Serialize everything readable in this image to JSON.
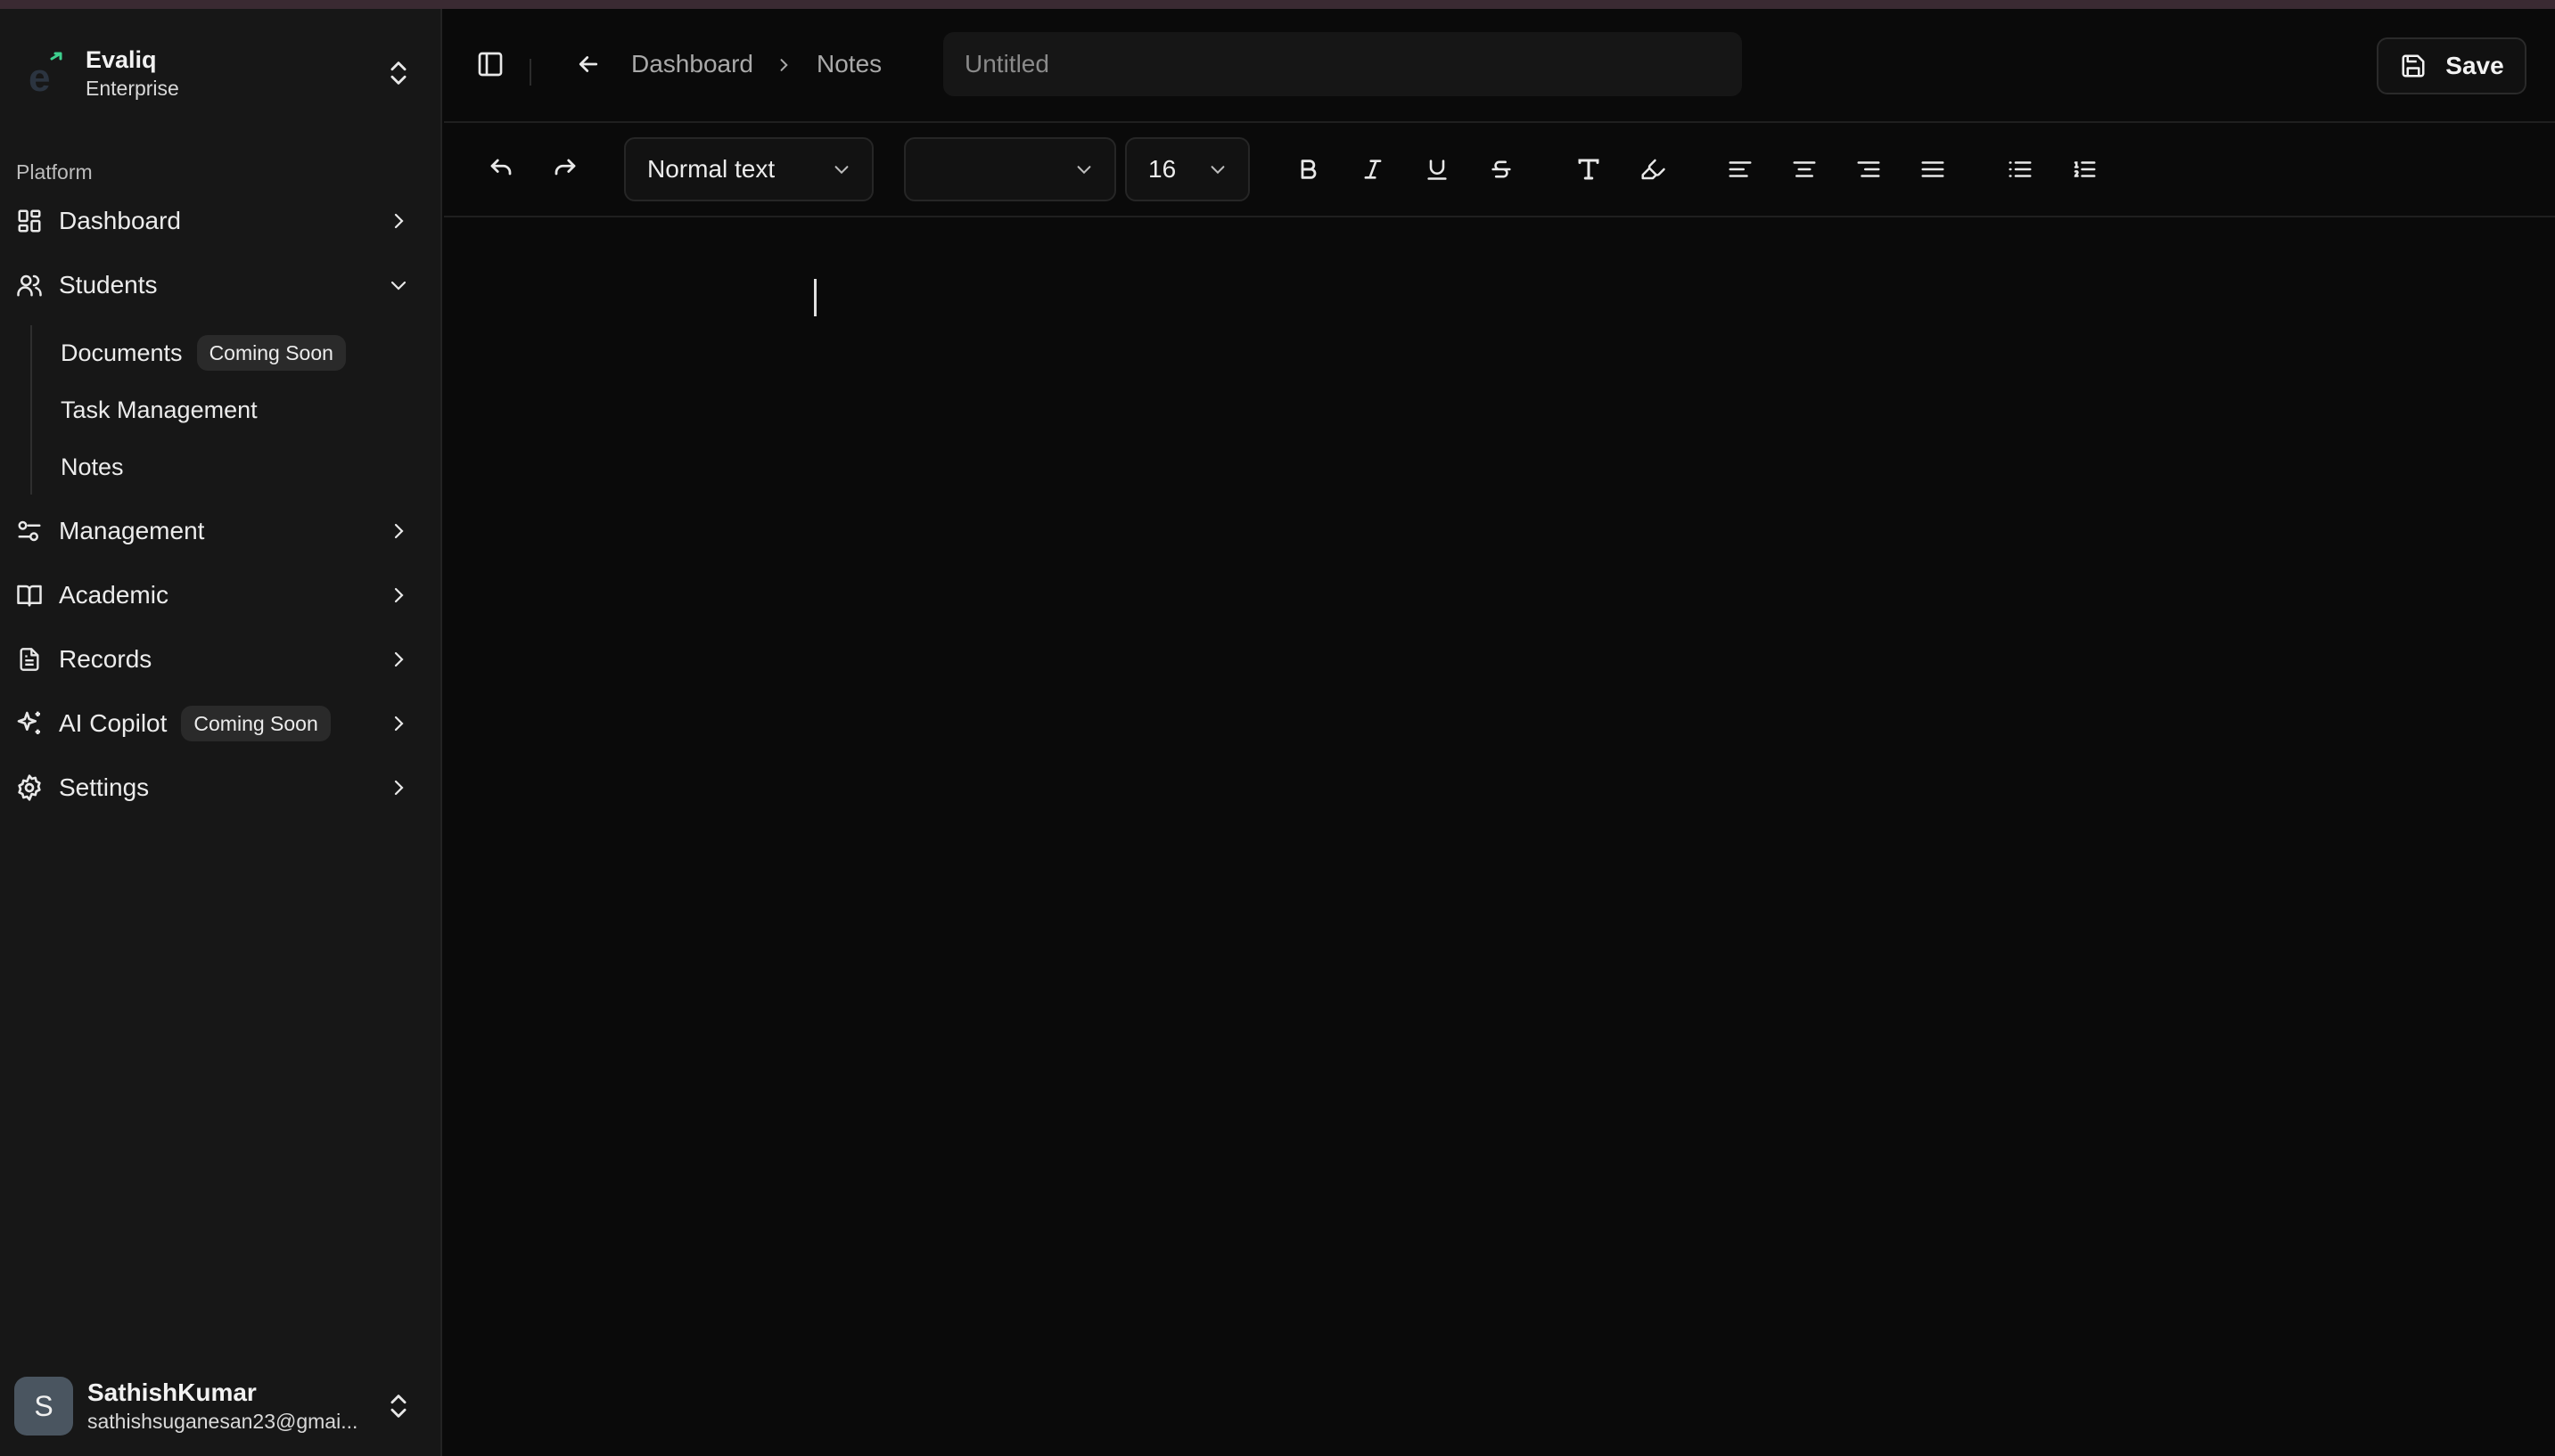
{
  "brand": {
    "name": "Evaliq",
    "plan": "Enterprise"
  },
  "sidebar": {
    "section_label": "Platform",
    "items": [
      {
        "label": "Dashboard"
      },
      {
        "label": "Students"
      },
      {
        "label": "Management"
      },
      {
        "label": "Academic"
      },
      {
        "label": "Records"
      },
      {
        "label": "AI Copilot",
        "badge": "Coming Soon"
      },
      {
        "label": "Settings"
      }
    ],
    "students_sub": [
      {
        "label": "Documents",
        "badge": "Coming Soon"
      },
      {
        "label": "Task Management"
      },
      {
        "label": "Notes"
      }
    ]
  },
  "user": {
    "name": "SathishKumar",
    "email": "sathishsuganesan23@gmai...",
    "initial": "S"
  },
  "header": {
    "breadcrumb": [
      "Dashboard",
      "Notes"
    ],
    "title_placeholder": "Untitled",
    "save_label": "Save"
  },
  "toolbar": {
    "block_type": "Normal text",
    "font_family": "",
    "font_size": "16"
  },
  "colors": {
    "background": "#0a0a0a",
    "sidebar": "#171717",
    "accent": "#3ecf8e"
  }
}
